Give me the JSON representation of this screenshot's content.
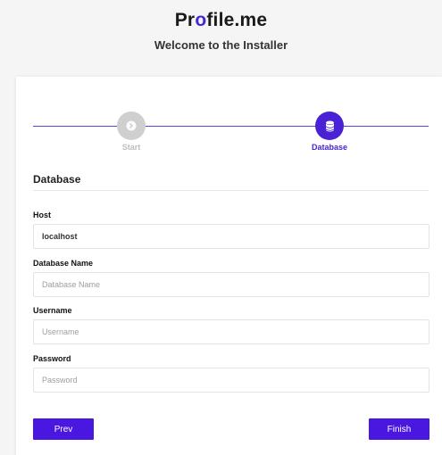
{
  "header": {
    "logo_text_start": "Pr",
    "logo_o": "o",
    "logo_text_end": "file.me",
    "subtitle": "Welcome to the Installer"
  },
  "steps": [
    {
      "label": "Start",
      "icon": "arrow-right-icon",
      "state": "completed"
    },
    {
      "label": "Database",
      "icon": "database-icon",
      "state": "active"
    }
  ],
  "form": {
    "section_title": "Database",
    "host": {
      "label": "Host",
      "value": "localhost",
      "placeholder": "Host"
    },
    "database_name": {
      "label": "Database Name",
      "value": "",
      "placeholder": "Database Name"
    },
    "username": {
      "label": "Username",
      "value": "",
      "placeholder": "Username"
    },
    "password": {
      "label": "Password",
      "value": "",
      "placeholder": "Password"
    }
  },
  "buttons": {
    "prev": "Prev",
    "finish": "Finish"
  },
  "colors": {
    "accent": "#4a17e0",
    "line": "#5a47d6",
    "inactive_step": "#cfcfcf"
  }
}
